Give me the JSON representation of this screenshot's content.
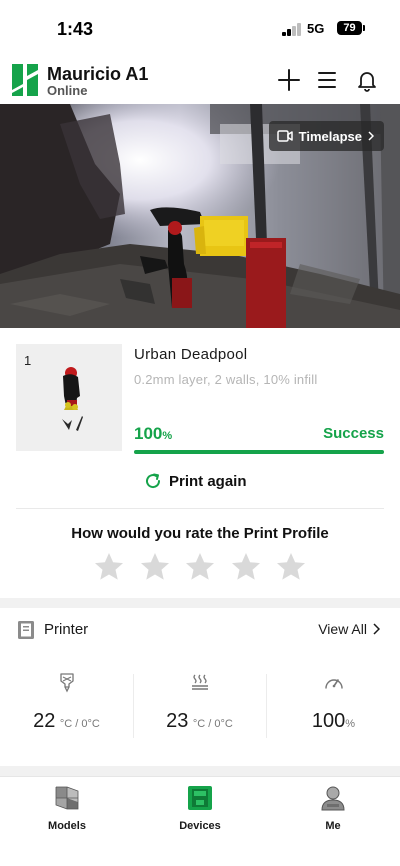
{
  "status_bar": {
    "time": "1:43",
    "network": "5G",
    "battery": "79"
  },
  "header": {
    "device_name": "Mauricio A1",
    "device_status": "Online"
  },
  "camera": {
    "timelapse_label": "Timelapse"
  },
  "job": {
    "plate_number": "1",
    "model_name": "Urban Deadpool",
    "settings": "0.2mm layer, 2 walls, 10% infill",
    "progress_value": "100",
    "progress_unit": "%",
    "progress_fraction": 1.0,
    "status": "Success",
    "print_again_label": "Print again"
  },
  "rating": {
    "title": "How would you rate the Print Profile",
    "star_count": 5,
    "selected": 0
  },
  "printer": {
    "title": "Printer",
    "view_all_label": "View All",
    "stats": [
      {
        "icon": "nozzle-temperature-icon",
        "value": "22",
        "unit": "°C / 0°C"
      },
      {
        "icon": "bed-temperature-icon",
        "value": "23",
        "unit": "°C / 0°C"
      },
      {
        "icon": "speed-gauge-icon",
        "value": "100",
        "unit": "%"
      }
    ]
  },
  "nav": {
    "items": [
      {
        "label": "Models",
        "icon": "models-cube-icon",
        "active": false
      },
      {
        "label": "Devices",
        "icon": "devices-printer-icon",
        "active": true
      },
      {
        "label": "Me",
        "icon": "profile-person-icon",
        "active": false
      }
    ]
  },
  "colors": {
    "accent": "#15a34a",
    "star": "#d9d9d9",
    "text": "#1a1a1a"
  }
}
